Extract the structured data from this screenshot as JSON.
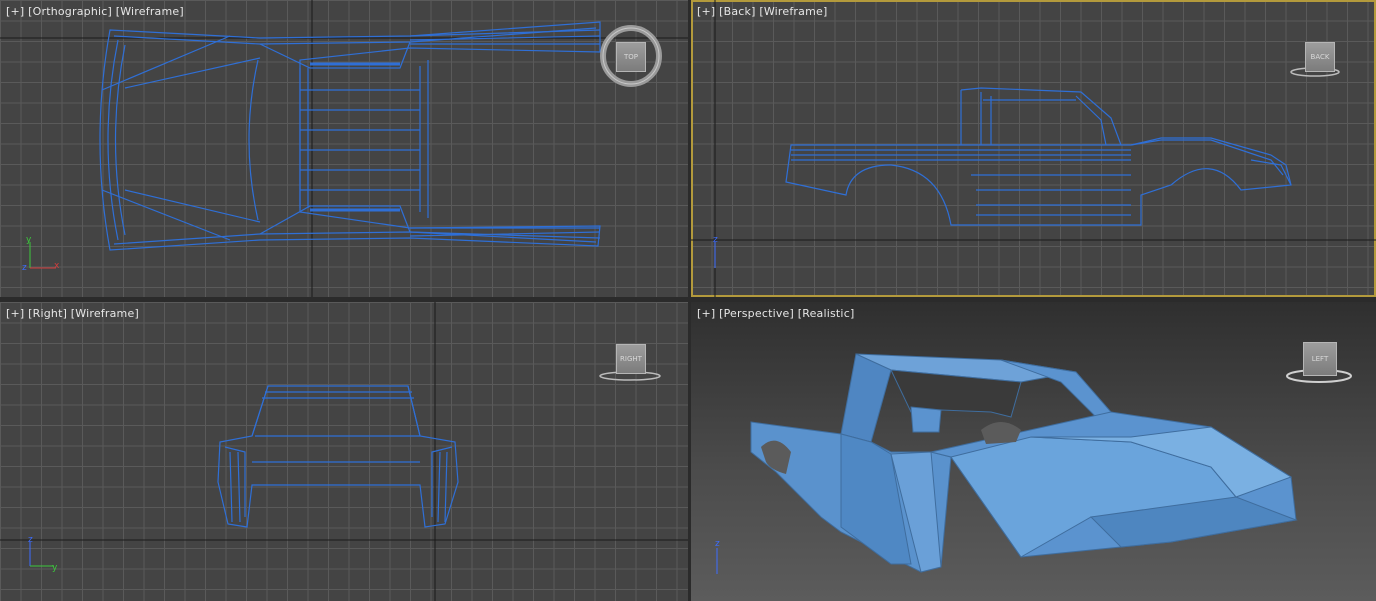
{
  "viewports": {
    "top": {
      "plus": "+",
      "view": "Orthographic",
      "shading": "Wireframe",
      "cube_label": "TOP"
    },
    "back": {
      "plus": "+",
      "view": "Back",
      "shading": "Wireframe",
      "cube_label": "BACK"
    },
    "right": {
      "plus": "+",
      "view": "Right",
      "shading": "Wireframe",
      "cube_label": "RIGHT"
    },
    "persp": {
      "plus": "+",
      "view": "Perspective",
      "shading": "Realistic",
      "cube_label": "LEFT"
    }
  },
  "axis_labels": {
    "x": "x",
    "y": "y",
    "z": "z"
  },
  "colors": {
    "wire": "#2f6fd6",
    "body_fill": "#5b93cf",
    "active_border": "#b39a3c",
    "grid_bg": "#444444",
    "axis_x": "#d23c3c",
    "axis_y": "#3cc83c",
    "axis_z": "#3c6cff"
  },
  "active_viewport": "back"
}
